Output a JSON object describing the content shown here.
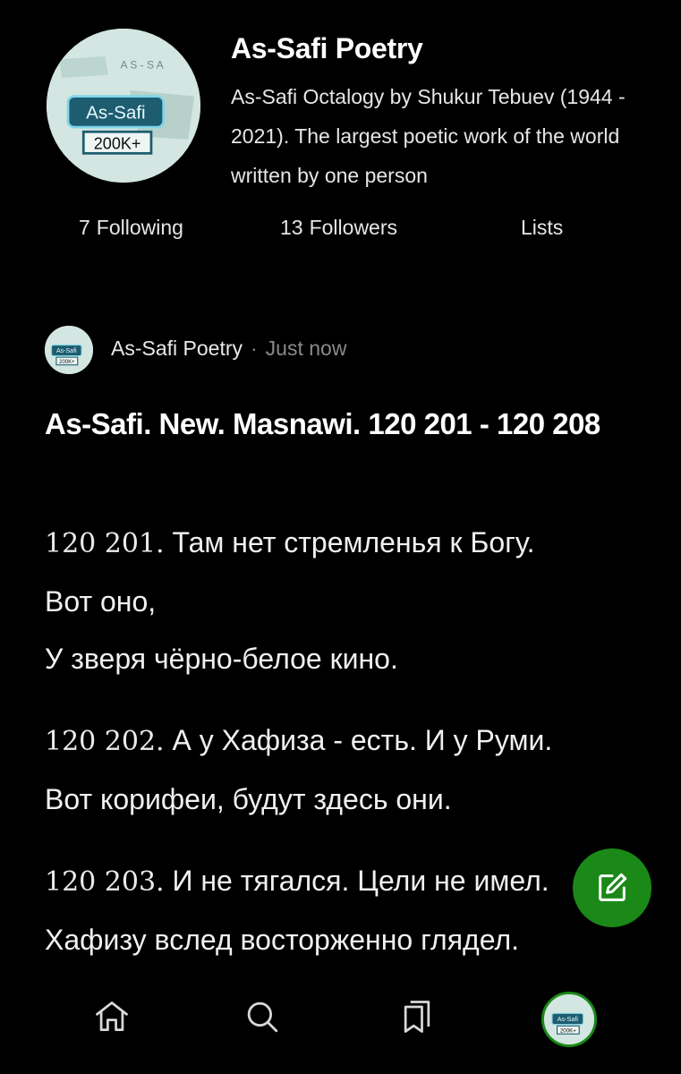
{
  "profile": {
    "name": "As-Safi Poetry",
    "bio": "As-Safi Octalogy by Shukur Tebuev (1944 - 2021). The largest poetic work of the world written by one person",
    "logo": {
      "title": "As-Safi",
      "count": "200K+"
    },
    "stats": {
      "following_count": "7",
      "following_label": "Following",
      "followers_count": "13",
      "followers_label": "Followers",
      "lists_label": "Lists"
    }
  },
  "post": {
    "author": "As-Safi Poetry",
    "separator": "·",
    "time": "Just now",
    "title": "As-Safi. New. Masnawi. 120 201 - 120 208",
    "verses": [
      {
        "number": "120 201.",
        "line1": "Там нет стремленья к Богу.",
        "line2": "Вот оно,",
        "line3": "У зверя чёрно-белое кино."
      },
      {
        "number": "120 202.",
        "line1": "А у Хафиза - есть. И у Руми.",
        "line2": "Вот корифеи, будут здесь они."
      },
      {
        "number": "120 203.",
        "line1": "И не тягался. Цели не имел.",
        "line2": "Хафизу вслед восторженно глядел."
      }
    ]
  },
  "fab": {
    "icon": "edit-icon",
    "color": "#1a8917"
  },
  "nav": {
    "items": [
      "home-icon",
      "search-icon",
      "bookmarks-icon",
      "profile-avatar"
    ]
  },
  "colors": {
    "background": "#000000",
    "text": "#ffffff",
    "muted": "#8a8a8a",
    "accent": "#1a8917"
  }
}
